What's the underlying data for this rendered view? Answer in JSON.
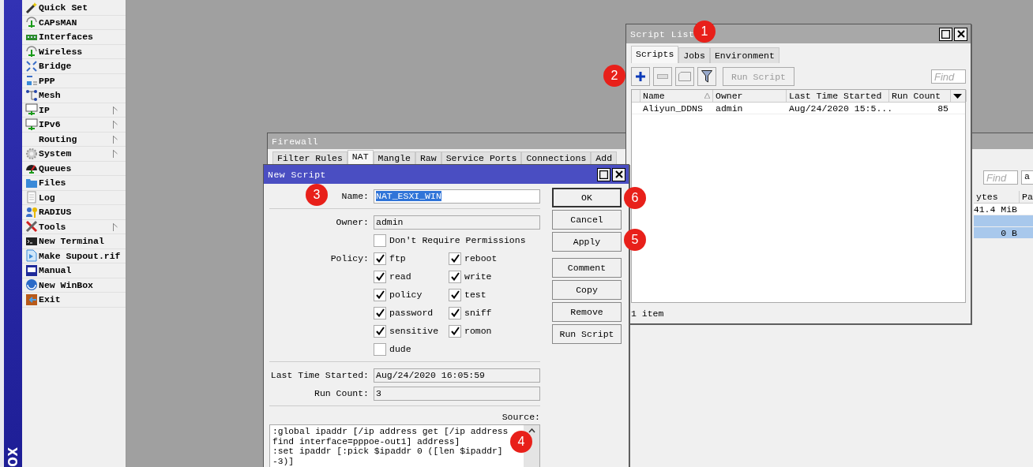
{
  "sidebar": {
    "brand": "OX",
    "items": [
      {
        "label": "Quick Set",
        "submenu": false
      },
      {
        "label": "CAPsMAN",
        "submenu": false
      },
      {
        "label": "Interfaces",
        "submenu": false
      },
      {
        "label": "Wireless",
        "submenu": false
      },
      {
        "label": "Bridge",
        "submenu": false
      },
      {
        "label": "PPP",
        "submenu": false
      },
      {
        "label": "Mesh",
        "submenu": false
      },
      {
        "label": "IP",
        "submenu": true
      },
      {
        "label": "IPv6",
        "submenu": true
      },
      {
        "label": "Routing",
        "submenu": true
      },
      {
        "label": "System",
        "submenu": true
      },
      {
        "label": "Queues",
        "submenu": false
      },
      {
        "label": "Files",
        "submenu": false
      },
      {
        "label": "Log",
        "submenu": false
      },
      {
        "label": "RADIUS",
        "submenu": false
      },
      {
        "label": "Tools",
        "submenu": true
      },
      {
        "label": "New Terminal",
        "submenu": false
      },
      {
        "label": "Make Supout.rif",
        "submenu": false
      },
      {
        "label": "Manual",
        "submenu": false
      },
      {
        "label": "New WinBox",
        "submenu": false
      },
      {
        "label": "Exit",
        "submenu": false
      }
    ]
  },
  "firewall": {
    "title": "Firewall",
    "active": false,
    "tabs": [
      {
        "label": "Filter Rules",
        "selected": false
      },
      {
        "label": "NAT",
        "selected": true
      },
      {
        "label": "Mangle",
        "selected": false
      },
      {
        "label": "Raw",
        "selected": false
      },
      {
        "label": "Service Ports",
        "selected": false
      },
      {
        "label": "Connections",
        "selected": false
      },
      {
        "label": "Add",
        "selected": false
      }
    ],
    "find": {
      "placeholder": "Find"
    },
    "filter_value": "a",
    "columns": [
      "ytes",
      "Pa"
    ],
    "rows": [
      {
        "cells": [
          "41.4 MiB"
        ],
        "selected": false
      },
      {
        "selected": true
      },
      {
        "cells": [
          "0 B"
        ],
        "selected": true
      }
    ]
  },
  "script_list": {
    "title": "Script List",
    "active": false,
    "tabs": [
      {
        "label": "Scripts",
        "selected": true
      },
      {
        "label": "Jobs",
        "selected": false
      },
      {
        "label": "Environment",
        "selected": false
      }
    ],
    "toolbar": [
      {
        "kind": "add",
        "disabled": false
      },
      {
        "kind": "remove",
        "disabled": true
      },
      {
        "kind": "comment",
        "disabled": true
      },
      {
        "kind": "filter",
        "disabled": false
      },
      {
        "kind": "text",
        "label": "Run Script",
        "disabled": true
      }
    ],
    "find": {
      "placeholder": "Find"
    },
    "columns": [
      {
        "label": "Name",
        "sorted": true
      },
      {
        "label": "Owner",
        "sorted": false
      },
      {
        "label": "Last Time Started",
        "sorted": false
      },
      {
        "label": "Run Count",
        "sorted": false
      }
    ],
    "rows": [
      {
        "cells": [
          "Aliyun_DDNS",
          "admin",
          "Aug/24/2020 15:5...",
          "85"
        ],
        "selected": false
      }
    ],
    "status": "1 item"
  },
  "new_script": {
    "title": "New Script",
    "active": true,
    "name": {
      "label": "Name:",
      "value": "NAT_ESXI_WIN",
      "highlighted": true
    },
    "owner": {
      "label": "Owner:",
      "value": "admin"
    },
    "dont_require": {
      "label": "Don't Require Permissions",
      "checked": false
    },
    "policy": {
      "label": "Policy:",
      "options": [
        {
          "label": "ftp",
          "checked": true
        },
        {
          "label": "reboot",
          "checked": true
        },
        {
          "label": "read",
          "checked": true
        },
        {
          "label": "write",
          "checked": true
        },
        {
          "label": "policy",
          "checked": true
        },
        {
          "label": "test",
          "checked": true
        },
        {
          "label": "password",
          "checked": true
        },
        {
          "label": "sniff",
          "checked": true
        },
        {
          "label": "sensitive",
          "checked": true
        },
        {
          "label": "romon",
          "checked": true
        },
        {
          "label": "dude",
          "checked": false
        }
      ]
    },
    "last_started": {
      "label": "Last Time Started:",
      "value": "Aug/24/2020 16:05:59"
    },
    "run_count": {
      "label": "Run Count:",
      "value": "3"
    },
    "source": {
      "label": "Source:",
      "lines": [
        ":global ipaddr [/ip address get [/ip address",
        "find interface=pppoe-out1] address]",
        ":set ipaddr [:pick $ipaddr 0 ([len $ipaddr]",
        "-3)]"
      ]
    },
    "buttons": [
      {
        "label": "OK",
        "default": true
      },
      {
        "label": "Cancel",
        "default": false
      },
      {
        "label": "Apply",
        "default": false
      },
      {
        "label": "Comment",
        "default": false
      },
      {
        "label": "Copy",
        "default": false
      },
      {
        "label": "Remove",
        "default": false
      },
      {
        "label": "Run Script",
        "default": false
      }
    ]
  },
  "annotations": [
    {
      "label": "1"
    },
    {
      "label": "2"
    },
    {
      "label": "3"
    },
    {
      "label": "4"
    },
    {
      "label": "5"
    },
    {
      "label": "6"
    }
  ]
}
